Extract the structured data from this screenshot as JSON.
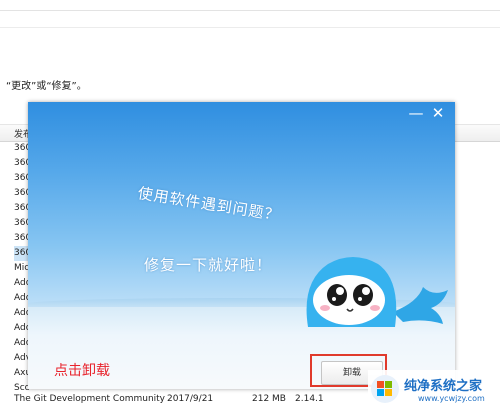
{
  "background": {
    "hint_text": "“更改”或“修复”。",
    "column_header_publisher": "发布",
    "publisher_rows": [
      "360",
      "360",
      "360",
      "360",
      "360",
      "360",
      "360",
      "360",
      "Mic",
      "Ado",
      "Ado",
      "Ado",
      "Ado",
      "Ado",
      "Adv",
      "Axu",
      "Sco"
    ],
    "highlighted_row_index": 7,
    "last_row": {
      "publisher": "The Git Development Community",
      "date": "2017/9/21",
      "size": "212 MB",
      "version": "2.14.1"
    }
  },
  "dialog": {
    "message_line1": "使用软件遇到问题？",
    "message_line2": "修复一下就好啦！",
    "minimize_icon": "—",
    "close_icon": "✕",
    "uninstall_button": "卸载"
  },
  "annotation": {
    "text": "点击卸载",
    "color": "#e8232c"
  },
  "watermark": {
    "title": "纯净系统之家",
    "url": "www.ycwjzy.com"
  }
}
